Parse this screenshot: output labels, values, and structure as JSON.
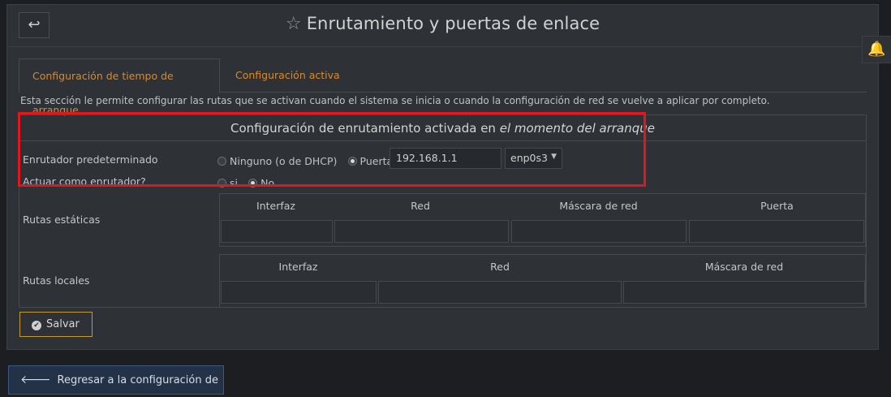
{
  "header": {
    "back_icon": "return-arrow",
    "title": "Enrutamiento y puertas de enlace",
    "star_icon": "star-outline"
  },
  "notifications": {
    "icon": "bell"
  },
  "tabs": [
    {
      "label": "Configuración de tiempo de arranque",
      "active": true
    },
    {
      "label": "Configuración activa",
      "active": false
    }
  ],
  "description": "Esta sección le permite configurar las rutas que se activan cuando el sistema se inicia o cuando la configuración de red se vuelve a aplicar por completo.",
  "section": {
    "title_prefix": "Configuración de enrutamiento activada en ",
    "title_emphasis": "el momento del arranque"
  },
  "default_router": {
    "label": "Enrutador predeterminado",
    "option_none": "Ninguno (o de DHCP)",
    "option_gateway": "Puerta",
    "selected": "gateway",
    "ip_value": "192.168.1.1",
    "interface": "enp0s3"
  },
  "act_as_router": {
    "label": "Actuar como enrutador?",
    "option_yes": "si",
    "option_no": "No",
    "selected": "no"
  },
  "static_routes": {
    "label": "Rutas estáticas",
    "columns": [
      "Interfaz",
      "Red",
      "Máscara de red",
      "Puerta"
    ]
  },
  "local_routes": {
    "label": "Rutas locales",
    "columns": [
      "Interfaz",
      "Red",
      "Máscara de red"
    ]
  },
  "buttons": {
    "save": "Salvar",
    "back_to_network": "Regresar a la configuración de red"
  },
  "colors": {
    "accent_orange": "#d98b2b",
    "highlight_red": "#e0181e",
    "panel_bg": "#2e3136",
    "page_bg": "#1c1e22"
  }
}
